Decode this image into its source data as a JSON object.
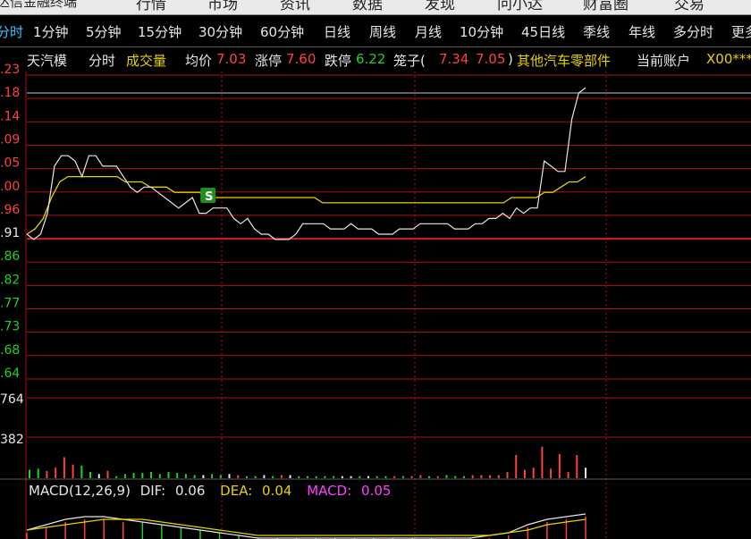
{
  "menu": {
    "app_title": "达信金融终端",
    "items": [
      "行情",
      "市场",
      "资讯",
      "数据",
      "发现",
      "问小达",
      "财富圈",
      "交易"
    ]
  },
  "periods": [
    {
      "label": "分时",
      "active": true
    },
    {
      "label": "1分钟"
    },
    {
      "label": "5分钟"
    },
    {
      "label": "15分钟"
    },
    {
      "label": "30分钟"
    },
    {
      "label": "60分钟"
    },
    {
      "label": "日线"
    },
    {
      "label": "周线"
    },
    {
      "label": "月线"
    },
    {
      "label": "10分钟"
    },
    {
      "label": "45日线"
    },
    {
      "label": "季线"
    },
    {
      "label": "年线"
    },
    {
      "label": "多分时"
    },
    {
      "label": "更多"
    }
  ],
  "info": {
    "stock_name": "天汽模",
    "mode": "分时",
    "volume_label": "成交量",
    "avg_label": "均价",
    "avg_value": "7.03",
    "limit_up_label": "涨停",
    "limit_up_value": "7.60",
    "limit_down_label": "跌停",
    "limit_down_value": "6.22",
    "cage_label": "笼子(",
    "cage_low": "7.34",
    "cage_high": "7.05",
    "cage_close": ")",
    "sector": "其他汽车零部件",
    "account_label": "当前账户",
    "account_value": "X00***"
  },
  "price_axis": {
    "labels": [
      ".23",
      ".18",
      ".14",
      ".09",
      ".05",
      ".00",
      ".96",
      ".91",
      ".86",
      ".82",
      ".77",
      ".73",
      ".68",
      ".64"
    ],
    "colors": [
      "#ff4040",
      "#ff4040",
      "#ff4040",
      "#ff4040",
      "#ff4040",
      "#ff4040",
      "#ff4040",
      "#e6e6e6",
      "#20d020",
      "#20d020",
      "#20d020",
      "#20d020",
      "#20d020",
      "#20d020"
    ]
  },
  "volume_axis": {
    "labels": [
      "764",
      "382"
    ]
  },
  "chart_data": {
    "type": "line",
    "price": [
      6.91,
      6.9,
      6.91,
      6.95,
      7.04,
      7.06,
      7.06,
      7.05,
      7.02,
      7.06,
      7.06,
      7.04,
      7.04,
      7.04,
      7.02,
      7.0,
      6.99,
      7.0,
      7.0,
      6.99,
      6.98,
      6.97,
      6.96,
      6.97,
      6.98,
      6.95,
      6.95,
      6.96,
      6.96,
      6.96,
      6.94,
      6.93,
      6.94,
      6.92,
      6.91,
      6.91,
      6.9,
      6.9,
      6.9,
      6.91,
      6.93,
      6.93,
      6.93,
      6.93,
      6.92,
      6.92,
      6.92,
      6.93,
      6.92,
      6.92,
      6.92,
      6.91,
      6.91,
      6.91,
      6.92,
      6.92,
      6.92,
      6.93,
      6.93,
      6.93,
      6.93,
      6.93,
      6.92,
      6.92,
      6.92,
      6.93,
      6.93,
      6.94,
      6.94,
      6.95,
      6.94,
      6.96,
      6.95,
      6.96,
      6.96,
      7.05,
      7.04,
      7.03,
      7.03,
      7.13,
      7.18,
      7.19
    ],
    "avg": [
      6.91,
      6.92,
      6.94,
      6.98,
      7.01,
      7.02,
      7.02,
      7.02,
      7.02,
      7.02,
      7.02,
      7.02,
      7.01,
      7.01,
      7.01,
      7.0,
      7.0,
      7.0,
      6.99,
      6.99,
      6.99,
      6.99,
      6.98,
      6.98,
      6.98,
      6.98,
      6.98,
      6.98,
      6.98,
      6.98,
      6.98,
      6.98,
      6.98,
      6.98,
      6.98,
      6.98,
      6.97,
      6.97,
      6.97,
      6.97,
      6.97,
      6.97,
      6.97,
      6.97,
      6.97,
      6.97,
      6.97,
      6.97,
      6.97,
      6.97,
      6.97,
      6.97,
      6.97,
      6.97,
      6.97,
      6.97,
      6.97,
      6.97,
      6.97,
      6.98,
      6.98,
      6.98,
      6.98,
      6.99,
      6.99,
      7.0,
      7.01,
      7.01,
      7.02
    ],
    "volume": [
      80,
      90,
      70,
      100,
      200,
      130,
      120,
      60,
      40,
      70,
      20,
      40,
      50,
      50,
      60,
      40,
      60,
      50,
      40,
      30,
      30,
      40,
      30,
      40,
      30,
      20,
      20,
      30,
      20,
      30,
      30,
      20,
      20,
      20,
      20,
      20,
      20,
      20,
      20,
      20,
      20,
      20,
      20,
      20,
      20,
      30,
      20,
      20,
      30,
      20,
      20,
      30,
      30,
      30,
      30,
      60,
      220,
      80,
      100,
      300,
      90,
      230,
      60,
      220,
      100
    ],
    "volume_colors": [
      "#20d020",
      "#20d020",
      "#ff4040",
      "#ff4040",
      "#ff4040",
      "#ff4040",
      "#20d020",
      "#20d020",
      "#e6e6e6",
      "#ff4040",
      "#20d020",
      "#20d020",
      "#20d020",
      "#20d020",
      "#20d020",
      "#20d020",
      "#20d020",
      "#20d020",
      "#20d020",
      "#20d020",
      "#e6e6e6",
      "#20d020",
      "#20d020",
      "#e6e6e6",
      "#ff4040",
      "#20d020",
      "#20d020",
      "#e6e6e6",
      "#20d020",
      "#ff4040",
      "#e6e6e6",
      "#20d020",
      "#20d020",
      "#20d020",
      "#20d020",
      "#20d020",
      "#e6e6e6",
      "#e6e6e6",
      "#20d020",
      "#e6e6e6",
      "#20d020",
      "#20d020",
      "#ff4040",
      "#20d020",
      "#ff4040",
      "#ff4040",
      "#20d020",
      "#ff4040",
      "#20d020",
      "#20d020",
      "#20d020",
      "#ff4040",
      "#ff4040",
      "#ff4040",
      "#ff4040",
      "#ff4040",
      "#ff4040",
      "#ff4040",
      "#ff4040",
      "#ff4040",
      "#ff4040",
      "#ff4040",
      "#ff4040",
      "#ff4040",
      "#e6e6e6"
    ],
    "volume_max": 764
  },
  "signal": {
    "label": "S",
    "index": 24
  },
  "macd": {
    "label": "MACD(12,26,9)",
    "dif_label": "DIF:",
    "dif_value": "0.06",
    "dea_label": "DEA:",
    "dea_value": "0.04",
    "macd_label": "MACD:",
    "macd_value": "0.05",
    "dif": [
      0.0,
      0.02,
      0.04,
      0.05,
      0.05,
      0.04,
      0.03,
      0.02,
      0.01,
      0.0,
      -0.01,
      -0.02,
      -0.03,
      -0.03,
      -0.03,
      -0.03,
      -0.03,
      -0.03,
      -0.03,
      -0.03,
      -0.03,
      -0.03,
      -0.03,
      -0.03,
      -0.02,
      -0.01,
      0.02,
      0.04,
      0.05,
      0.06
    ],
    "dea": [
      0.0,
      0.01,
      0.02,
      0.03,
      0.04,
      0.04,
      0.04,
      0.03,
      0.02,
      0.01,
      0.0,
      -0.01,
      -0.02,
      -0.02,
      -0.02,
      -0.02,
      -0.02,
      -0.02,
      -0.02,
      -0.02,
      -0.02,
      -0.02,
      -0.02,
      -0.02,
      -0.02,
      -0.01,
      0.0,
      0.02,
      0.03,
      0.04
    ]
  },
  "colors": {
    "price_line": "#e6e6e6",
    "avg_line": "#e6d200",
    "grid": "#b01010",
    "grid_dotted": "#b01010",
    "up": "#ff4040",
    "down": "#20d020",
    "neutral": "#e6e6e6",
    "signal_bg": "#1f8f1f"
  }
}
